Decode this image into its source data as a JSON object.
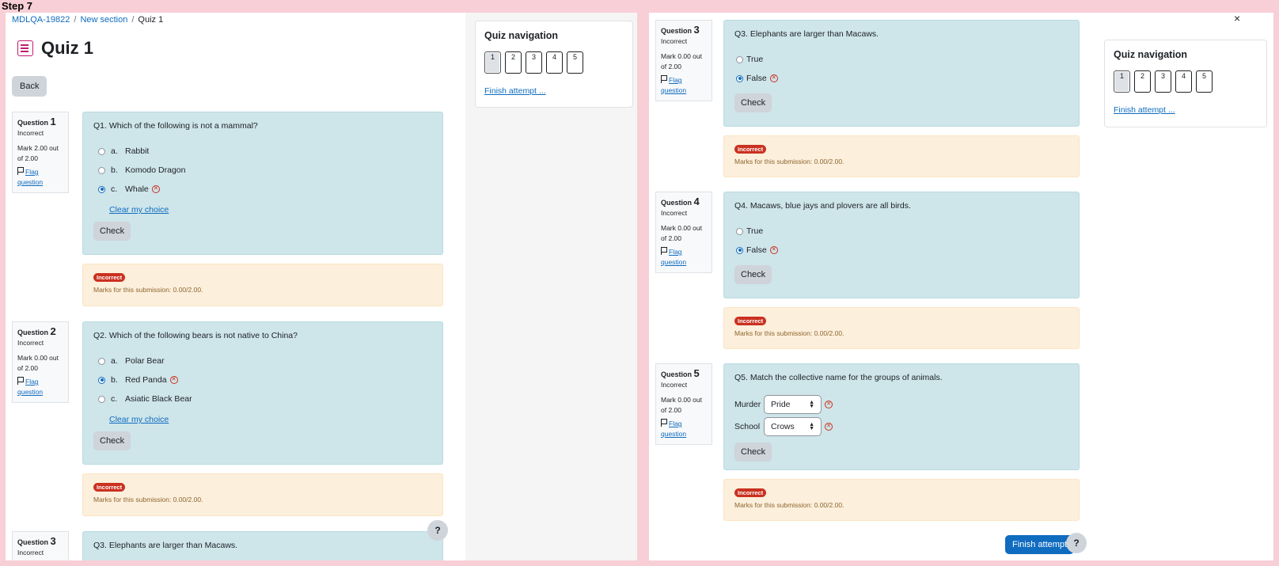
{
  "step_label": "Step 7",
  "breadcrumb": {
    "course": "MDLQA-19822",
    "section": "New section",
    "current": "Quiz 1"
  },
  "page_title": "Quiz 1",
  "back_label": "Back",
  "labels": {
    "question_word": "Question",
    "check": "Check",
    "flag": "Flag question",
    "clear_choice": "Clear my choice",
    "incorrect_badge": "Incorrect"
  },
  "questions": [
    {
      "number": "1",
      "state": "Incorrect",
      "mark": "Mark 2.00 out of 2.00",
      "text": "Q1. Which of the following is not a mammal?",
      "answers": [
        {
          "letter": "a.",
          "text": "Rabbit"
        },
        {
          "letter": "b.",
          "text": "Komodo Dragon"
        },
        {
          "letter": "c.",
          "text": "Whale",
          "selected": true
        }
      ],
      "feedback": "Marks for this submission: 0.00/2.00."
    },
    {
      "number": "2",
      "state": "Incorrect",
      "mark": "Mark 0.00 out of 2.00",
      "text": "Q2. Which of the following bears is not native to China?",
      "answers": [
        {
          "letter": "a.",
          "text": "Polar Bear"
        },
        {
          "letter": "b.",
          "text": "Red Panda",
          "selected": true
        },
        {
          "letter": "c.",
          "text": "Asiatic Black Bear"
        }
      ],
      "feedback": "Marks for this submission: 0.00/2.00."
    },
    {
      "number": "3",
      "state": "Incorrect",
      "mark": "Mark 0.00 out of 2.00",
      "text": "Q3. Elephants are larger than Macaws.",
      "answers": [
        {
          "text": "True"
        },
        {
          "text": "False",
          "selected": true
        }
      ],
      "feedback": "Marks for this submission: 0.00/2.00."
    },
    {
      "number": "4",
      "state": "Incorrect",
      "mark": "Mark 0.00 out of 2.00",
      "text": "Q4. Macaws, blue jays and plovers are all birds.",
      "answers": [
        {
          "text": "True"
        },
        {
          "text": "False",
          "selected": true
        }
      ],
      "feedback": "Marks for this submission: 0.00/2.00."
    },
    {
      "number": "5",
      "state": "Incorrect",
      "mark": "Mark 0.00 out of 2.00",
      "text": "Q5. Match the collective name for the groups of animals.",
      "matches": [
        {
          "label": "Murder",
          "value": "Pride"
        },
        {
          "label": "School",
          "value": "Crows"
        }
      ],
      "feedback": "Marks for this submission: 0.00/2.00."
    }
  ],
  "quiz_nav": {
    "title": "Quiz navigation",
    "buttons": [
      "1",
      "2",
      "3",
      "4",
      "5"
    ],
    "finish_link": "Finish attempt ..."
  },
  "finish_attempt_button": "Finish attempt",
  "help_icon": "?",
  "close_icon": "×",
  "icons": {
    "title": "quiz-icon",
    "flag": "flag-icon",
    "incorrect": "x-circle-icon"
  },
  "colors": {
    "question_bg": "#cee5ea",
    "feedback_bg": "#fcefdc",
    "incorrect": "#ca3120",
    "link": "#0f6cbf",
    "quiz_icon": "#c21b6f"
  }
}
